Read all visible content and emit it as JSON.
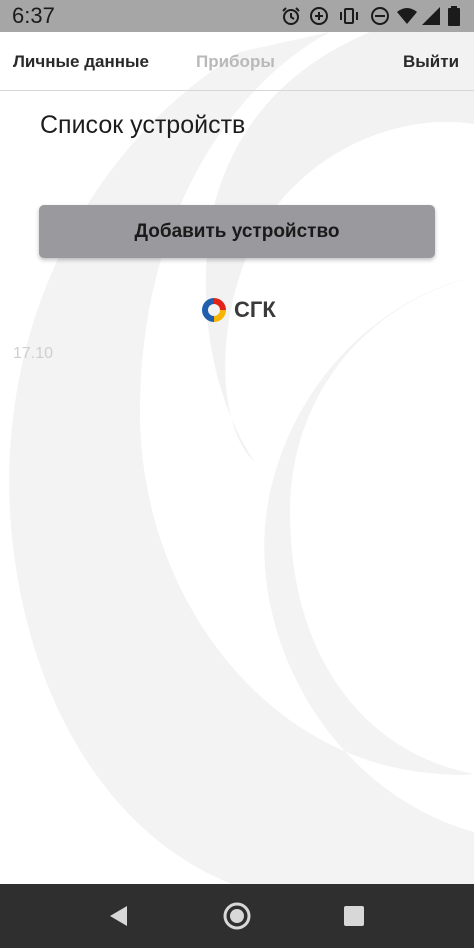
{
  "status_bar": {
    "time": "6:37",
    "icons": [
      "alarm-icon",
      "data-saver-icon",
      "vibrate-icon",
      "do-not-disturb-icon",
      "wifi-icon",
      "signal-icon",
      "battery-icon"
    ]
  },
  "top_nav": {
    "personal_data_label": "Личные данные",
    "devices_label": "Приборы",
    "logout_label": "Выйти",
    "active_tab": "devices"
  },
  "main": {
    "title": "Список устройств",
    "add_device_label": "Добавить устройство",
    "logo_text": "СГК",
    "version": "17.10"
  },
  "system_nav": {
    "buttons": [
      "back-icon",
      "home-icon",
      "recents-icon"
    ]
  },
  "colors": {
    "status_bar_bg": "#a6a6a6",
    "button_bg": "#9a9a9e",
    "nav_inactive": "#b9b9b9",
    "nav_active": "#2a2a2a",
    "logo_red": "#e2231a",
    "logo_yellow": "#f7b500",
    "logo_blue": "#1f5fad",
    "system_nav_bg": "#2f2f2f"
  }
}
